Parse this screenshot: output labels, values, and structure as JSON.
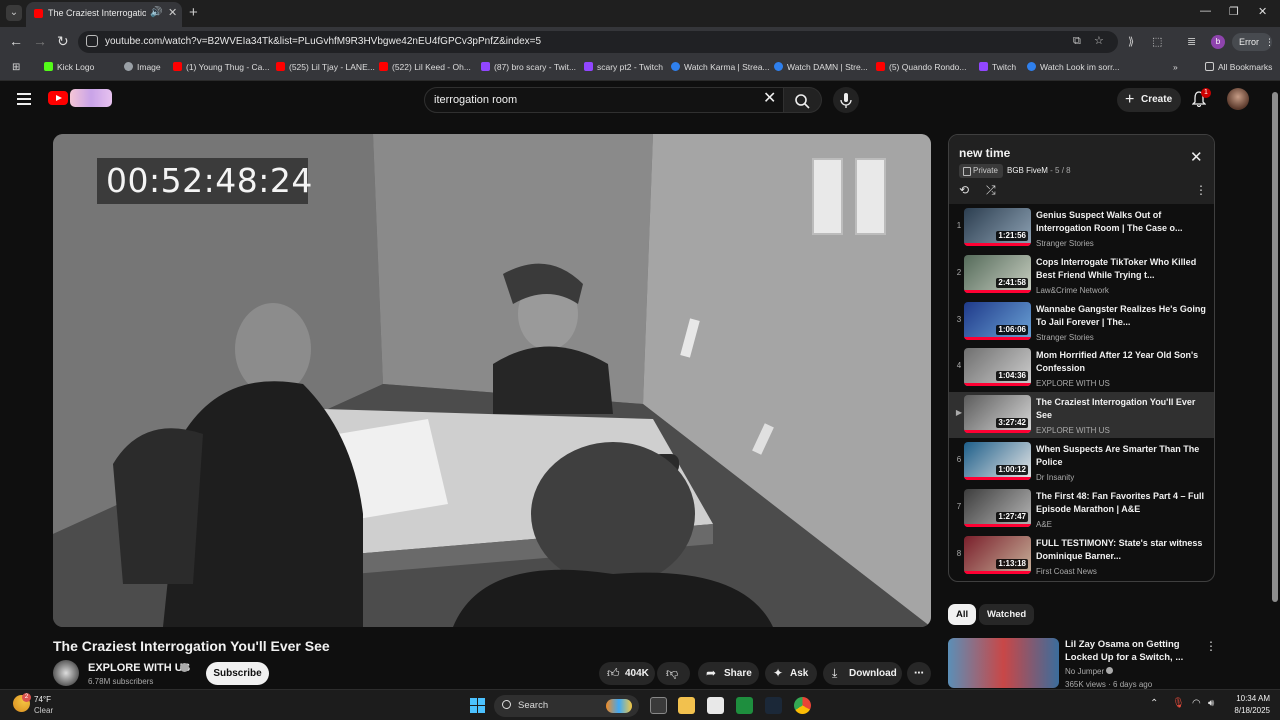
{
  "browser": {
    "tab_title": "The Craziest Interrogation You'll Ever See",
    "url": "youtube.com/watch?v=B2WVEIa34Tk&list=PLuGvhfM9R3HVbgwe42nEU4fGPCv3pPnfZ&index=5",
    "profile_initial": "b",
    "error_label": "Error",
    "bookmarks": [
      {
        "label": "Kick Logo",
        "color": "#53fc18"
      },
      {
        "label": "Image",
        "color": "#9aa0a6"
      },
      {
        "label": "(1) Young Thug - Ca...",
        "color": "#ff0000"
      },
      {
        "label": "(525) Lil Tjay - LANE...",
        "color": "#ff0000"
      },
      {
        "label": "(522) Lil Keed - Oh...",
        "color": "#ff0000"
      },
      {
        "label": "(87) bro scary - Twit...",
        "color": "#9146ff"
      },
      {
        "label": "scary pt2 - Twitch",
        "color": "#9146ff"
      },
      {
        "label": "Watch Karma | Strea...",
        "color": "#2f80ed"
      },
      {
        "label": "Watch DAMN | Stre...",
        "color": "#2f80ed"
      },
      {
        "label": "(5) Quando Rondo...",
        "color": "#ff0000"
      },
      {
        "label": "Twitch",
        "color": "#9146ff"
      },
      {
        "label": "Watch Look im sorr...",
        "color": "#2f80ed"
      }
    ],
    "all_bookmarks_label": "All Bookmarks"
  },
  "youtube": {
    "search_value": "iterrogation room",
    "create_label": "Create",
    "notification_count": "1"
  },
  "player": {
    "timecode": "00:52:48:24"
  },
  "video": {
    "title": "The Craziest Interrogation You'll Ever See",
    "channel": "EXPLORE WITH US",
    "subscribers": "6.78M subscribers",
    "subscribe_label": "Subscribe",
    "likes": "404K",
    "share_label": "Share",
    "ask_label": "Ask",
    "download_label": "Download"
  },
  "playlist": {
    "title": "new time",
    "privacy": "Private",
    "owner": "BGB FiveM",
    "position": "5 / 8",
    "items": [
      {
        "index": "1",
        "title": "Genius Suspect Walks Out of Interrogation Room | The Case o...",
        "channel": "Stranger Stories",
        "duration": "1:21:56",
        "thumb": [
          "#2c3e50",
          "#8fa3b5"
        ]
      },
      {
        "index": "2",
        "title": "Cops Interrogate TikToker Who Killed Best Friend While Trying t...",
        "channel": "Law&Crime Network",
        "duration": "2:41:58",
        "thumb": [
          "#556b5a",
          "#c9cfc2"
        ]
      },
      {
        "index": "3",
        "title": "Wannabe Gangster Realizes He's Going To Jail Forever | The...",
        "channel": "Stranger Stories",
        "duration": "1:06:06",
        "thumb": [
          "#1f3a8a",
          "#6ba3d6"
        ]
      },
      {
        "index": "4",
        "title": "Mom Horrified After 12 Year Old Son's Confession",
        "channel": "EXPLORE WITH US",
        "duration": "1:04:36",
        "thumb": [
          "#6f6f6f",
          "#cfcfcf"
        ]
      },
      {
        "index": "▶",
        "title": "The Craziest Interrogation You'll Ever See",
        "channel": "EXPLORE WITH US",
        "duration": "3:27:42",
        "thumb": [
          "#5c5c5c",
          "#d8d8d8"
        ],
        "active": true
      },
      {
        "index": "6",
        "title": "When Suspects Are Smarter Than The Police",
        "channel": "Dr Insanity",
        "duration": "1:00:12",
        "thumb": [
          "#1e5f8a",
          "#e7e7e7"
        ]
      },
      {
        "index": "7",
        "title": "The First 48: Fan Favorites Part 4 – Full Episode Marathon | A&E",
        "channel": "A&E",
        "duration": "1:27:47",
        "thumb": [
          "#3d3d3d",
          "#b8b8b8"
        ]
      },
      {
        "index": "8",
        "title": "FULL TESTIMONY: State's star witness Dominique Barner...",
        "channel": "First Coast News",
        "duration": "1:13:18",
        "thumb": [
          "#7a1f2b",
          "#c7b19a"
        ]
      }
    ]
  },
  "chips": [
    "All",
    "Watched"
  ],
  "recommendation": {
    "title": "Lil Zay Osama on Getting Locked Up for a Switch, ...",
    "channel": "No Jumper",
    "meta": "365K views · 6 days ago"
  },
  "taskbar": {
    "temperature": "74°F",
    "condition": "Clear",
    "weather_badge": "2",
    "search_label": "Search",
    "time": "10:34 AM",
    "date": "8/18/2025"
  }
}
